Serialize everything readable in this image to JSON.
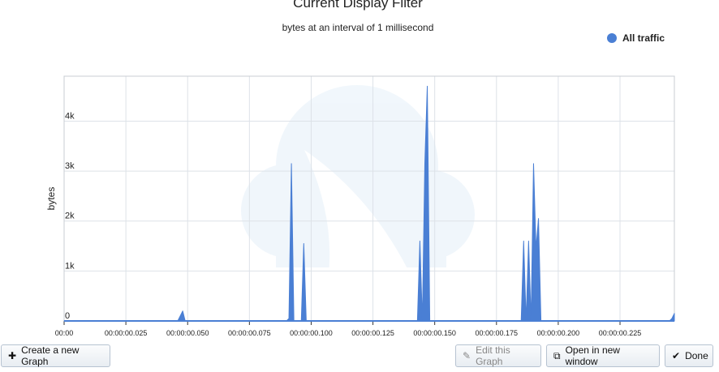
{
  "header": {
    "title": "Current Display Filter",
    "subtitle": "bytes at an interval of 1 millisecond"
  },
  "colors": {
    "series": "#4a7fd4",
    "grid": "#dde2e8",
    "axis": "#333333"
  },
  "chart_data": {
    "type": "area",
    "title": "Current Display Filter",
    "subtitle": "bytes at an interval of 1 millisecond",
    "xlabel": "",
    "ylabel": "bytes",
    "xlim": [
      0,
      0.247
    ],
    "ylim": [
      0,
      4900
    ],
    "grid": true,
    "legend_position": "top-right",
    "x_ticks": [
      0,
      0.025,
      0.05,
      0.075,
      0.1,
      0.125,
      0.15,
      0.175,
      0.2,
      0.225
    ],
    "x_tick_labels": [
      "00:00",
      "00:00:00.025",
      "00:00:00.050",
      "00:00:00.075",
      "00:00:00.100",
      "00:00:00.125",
      "00:00:00.150",
      "00:00:00.175",
      "00:00:00.200",
      "00:00:00.225"
    ],
    "y_ticks": [
      0,
      1000,
      2000,
      3000,
      4000
    ],
    "y_tick_labels": [
      "0",
      "1k",
      "2k",
      "3k",
      "4k"
    ],
    "series": [
      {
        "name": "All traffic",
        "color": "#4a7fd4",
        "x": [
          0,
          0.046,
          0.047,
          0.048,
          0.049,
          0.09,
          0.091,
          0.092,
          0.093,
          0.094,
          0.095,
          0.096,
          0.097,
          0.098,
          0.099,
          0.1,
          0.101,
          0.143,
          0.144,
          0.145,
          0.146,
          0.147,
          0.148,
          0.149,
          0.15,
          0.151,
          0.152,
          0.153,
          0.154,
          0.155,
          0.156,
          0.157,
          0.158,
          0.159,
          0.16,
          0.185,
          0.186,
          0.187,
          0.188,
          0.189,
          0.19,
          0.191,
          0.192,
          0.193,
          0.194,
          0.195,
          0.196,
          0.197,
          0.198,
          0.199,
          0.2,
          0.201,
          0.202,
          0.244,
          0.245,
          0.246,
          0.247
        ],
        "values": [
          0,
          0,
          100,
          200,
          0,
          0,
          50,
          3150,
          0,
          0,
          0,
          0,
          1550,
          0,
          0,
          0,
          0,
          0,
          1600,
          0,
          3150,
          4700,
          0,
          0,
          0,
          0,
          0,
          0,
          0,
          0,
          0,
          0,
          0,
          0,
          0,
          0,
          1600,
          0,
          1600,
          0,
          3150,
          1450,
          2050,
          0,
          0,
          0,
          0,
          0,
          0,
          0,
          0,
          0,
          0,
          0,
          0,
          50,
          150
        ]
      }
    ]
  },
  "buttons": {
    "create": "Create a new Graph",
    "edit": "Edit this Graph",
    "open": "Open in new window",
    "done": "Done"
  }
}
